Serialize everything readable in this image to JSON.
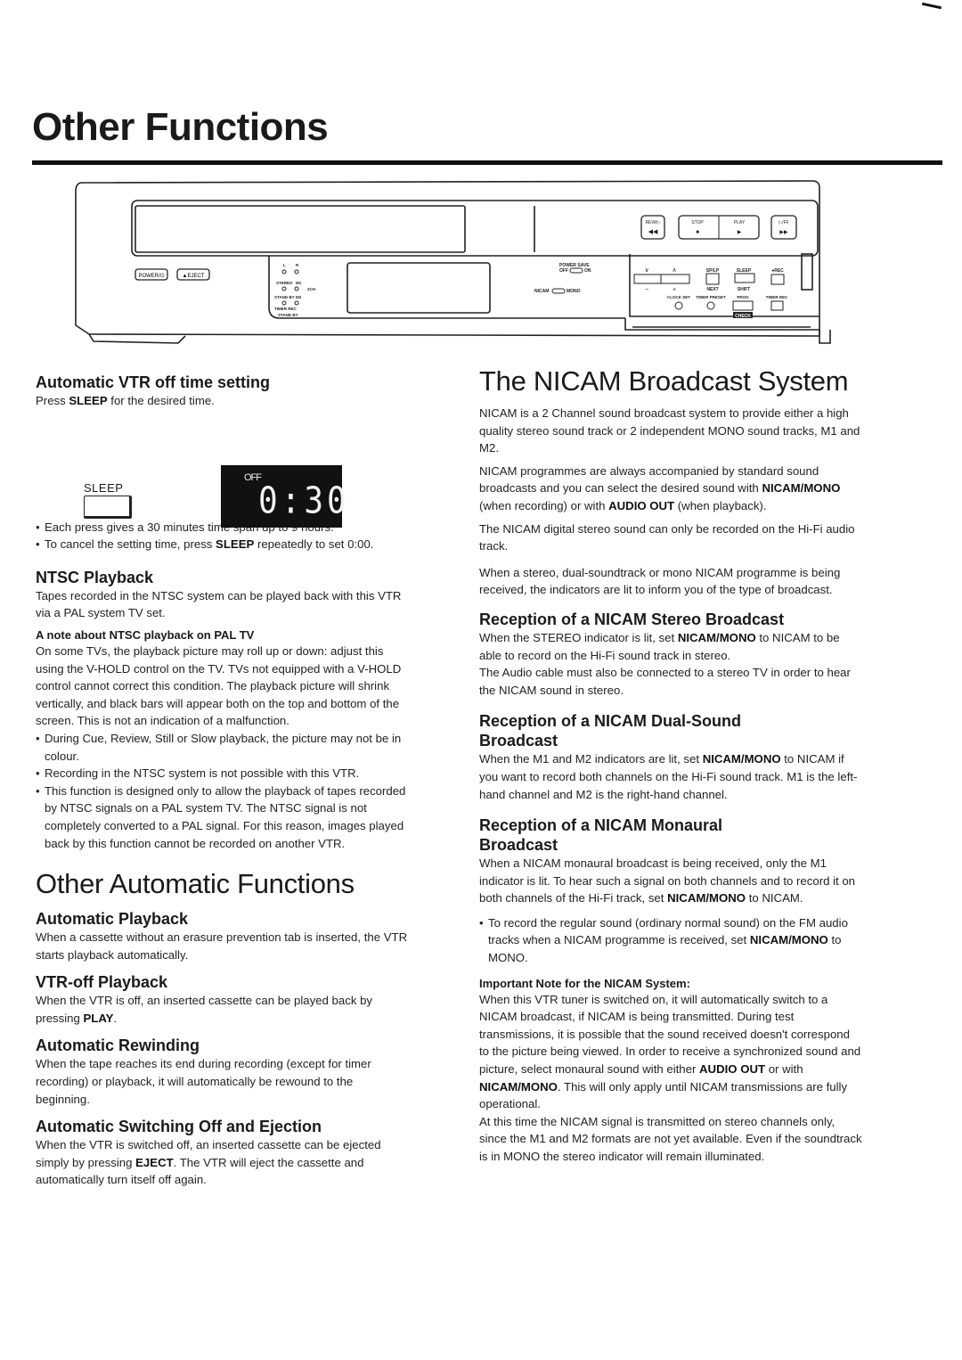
{
  "page": {
    "title": "Other Functions"
  },
  "vcr_panel": {
    "power_button": "POWER/⏻",
    "eject_button": "▲EJECT",
    "indicator_l": "L",
    "indicator_r": "R",
    "indicator_stereo": "STEREO",
    "indicator_m1": "M1",
    "indicator_2ch": "2CH",
    "indicator_standby": "STAND BY",
    "indicator_m2": "M2",
    "indicator_timer_rec": "TIMER REC",
    "indicator_timer_standby": "STAND BY",
    "power_save_label": "POWER SAVE",
    "power_save_off": "OFF",
    "power_save_on": "ON",
    "nicam_switch_left": "NICAM",
    "nicam_switch_right": "MONO",
    "rew_button": "REW/▷",
    "stop_button": "STOP",
    "play_button": "PLAY",
    "ff_button": "▷/FF",
    "rew_glyph": "◀◀",
    "stop_glyph": "■",
    "play_glyph": "▶",
    "ff_glyph": "▶▶",
    "ch_down": "∨",
    "ch_up": "∧",
    "minus": "−",
    "plus": "+",
    "sp_lp": "SP/LP",
    "next": "NEXT",
    "sleep": "SLEEP",
    "shift": "SHIFT",
    "rec": "●REC",
    "clock_set": "CLOCK SET",
    "timer_preset": "TIMER PRESET",
    "prog": "PROG",
    "timer_rec": "TIMER REC",
    "check": "CHECK"
  },
  "left_column": {
    "auto_off": {
      "heading": "Automatic VTR off time setting",
      "intro_pre": "Press ",
      "intro_bold": "SLEEP",
      "intro_post": " for the desired time.",
      "button_label": "SLEEP",
      "display_off": "OFF",
      "display_time": "0:30",
      "bullet1": "Each press gives a 30 minutes time span up to 9 hours.",
      "bullet2_pre": "To cancel the setting time, press ",
      "bullet2_bold": "SLEEP",
      "bullet2_post": " repeatedly to set 0:00."
    },
    "ntsc": {
      "heading": "NTSC Playback",
      "intro": "Tapes recorded in the NTSC system can be played back with this VTR via a PAL system TV set.",
      "note_heading": "A note about NTSC playback on PAL TV",
      "note_body": "On some TVs, the playback picture may roll up or down: adjust this using the V-HOLD control on the TV. TVs not equipped with a V-HOLD control cannot correct this condition. The playback picture will shrink vertically, and black bars will appear both on the top and bottom of the screen. This is not an indication of a malfunction.",
      "bullets": [
        "During Cue, Review, Still or Slow playback, the picture may not be in colour.",
        "Recording in the NTSC system is not possible with this VTR.",
        "This function is designed only to allow the playback of tapes recorded by NTSC signals on a PAL system TV. The NTSC signal is not completely converted to a PAL signal. For this reason, images played back by this function cannot be recorded on another VTR."
      ]
    },
    "other_auto": {
      "heading": "Other Automatic Functions",
      "auto_playback_heading": "Automatic Playback",
      "auto_playback_body": "When a cassette without an erasure prevention tab is inserted, the VTR starts playback automatically.",
      "vtr_off_heading": "VTR-off Playback",
      "vtr_off_pre": "When the VTR is off, an inserted cassette can be played back by pressing ",
      "vtr_off_bold": "PLAY",
      "vtr_off_post": ".",
      "rewind_heading": "Automatic Rewinding",
      "rewind_body": "When the tape reaches its end during recording (except for timer recording) or playback, it will automatically be rewound to the beginning.",
      "eject_heading": "Automatic Switching Off and Ejection",
      "eject_pre": "When the VTR is switched off, an inserted cassette can be ejected simply by pressing ",
      "eject_bold": "EJECT",
      "eject_post": ". The VTR will eject the cassette and automatically turn itself off again."
    }
  },
  "right_column": {
    "heading": "The NICAM Broadcast System",
    "p1": "NICAM is a 2 Channel sound broadcast system to provide either a high quality stereo sound track or 2 independent MONO sound tracks, M1 and M2.",
    "p2_pre": "NICAM programmes are always accompanied by standard sound broadcasts and you can select the desired sound with ",
    "p2_bold1": "NICAM/MONO",
    "p2_mid": " (when recording) or with ",
    "p2_bold2": "AUDIO OUT",
    "p2_post": " (when playback).",
    "p3": "The NICAM digital stereo sound can only be recorded on the Hi-Fi audio track.",
    "p4": "When a stereo, dual-soundtrack or mono NICAM programme is being received, the indicators are lit to inform you of the type of broadcast.",
    "stereo": {
      "heading": "Reception of a NICAM Stereo Broadcast",
      "pre": "When the STEREO indicator is lit, set ",
      "bold": "NICAM/MONO",
      "post": " to NICAM to be able to record on the Hi-Fi sound track in stereo.",
      "p2": "The Audio cable must also be connected to a stereo TV in order to hear the NICAM sound in stereo."
    },
    "dual": {
      "heading": "Reception of a NICAM Dual-Sound Broadcast",
      "pre": "When the M1 and M2 indicators are lit, set ",
      "bold": "NICAM/MONO",
      "post": " to NICAM if you want to record both channels on the Hi-Fi sound track. M1 is the left-hand channel and M2 is the right-hand channel."
    },
    "mono": {
      "heading": "Reception of a NICAM Monaural Broadcast",
      "pre": "When a NICAM monaural broadcast is being received, only the M1 indicator is lit. To hear such a signal on both channels and to record it on both channels of the Hi-Fi track, set ",
      "bold": "NICAM/MONO",
      "post": " to NICAM.",
      "bullet_pre": "To record the regular sound (ordinary normal sound) on the FM audio tracks when a NICAM programme is received, set ",
      "bullet_bold": "NICAM/MONO",
      "bullet_post": " to MONO."
    },
    "important": {
      "heading": "Important Note for the NICAM System:",
      "pre": "When this VTR tuner is switched on, it will automatically switch to a NICAM broadcast, if NICAM is being transmitted. During test transmissions, it is possible that the sound received doesn't correspond to the picture being viewed. In order to receive a synchronized sound and picture, select monaural sound with either ",
      "bold1": "AUDIO OUT",
      "mid": " or with ",
      "bold2": "NICAM/MONO",
      "post": ". This will only apply until NICAM transmissions are fully operational.",
      "p2": "At this time the NICAM signal is transmitted on stereo channels only, since the M1 and M2 formats are not yet available. Even if the soundtrack is in MONO the stereo indicator will remain illuminated."
    }
  }
}
